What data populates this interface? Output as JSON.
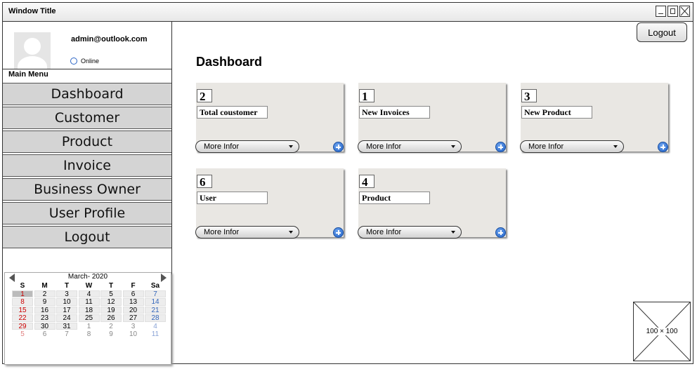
{
  "window": {
    "title": "Window Title"
  },
  "profile": {
    "email": "admin@outlook.com",
    "status": "Online"
  },
  "sidebar": {
    "menu_label": "Main Menu",
    "items": [
      {
        "label": "Dashboard"
      },
      {
        "label": "Customer"
      },
      {
        "label": "Product"
      },
      {
        "label": "Invoice"
      },
      {
        "label": "Business Owner"
      },
      {
        "label": "User Profile"
      },
      {
        "label": "Logout"
      }
    ]
  },
  "calendar": {
    "month_label": "March- 2020",
    "weekdays": [
      "S",
      "M",
      "T",
      "W",
      "T",
      "F",
      "Sa"
    ],
    "selected_day": 1,
    "weeks": [
      [
        1,
        2,
        3,
        4,
        5,
        6,
        7
      ],
      [
        8,
        9,
        10,
        11,
        12,
        13,
        14
      ],
      [
        15,
        16,
        17,
        18,
        19,
        20,
        21
      ],
      [
        22,
        23,
        24,
        25,
        26,
        27,
        28
      ],
      [
        29,
        30,
        31,
        1,
        2,
        3,
        4
      ],
      [
        5,
        6,
        7,
        8,
        9,
        10,
        11
      ]
    ],
    "colors": {
      "sunday": "#cc0000",
      "saturday": "#3366bb"
    }
  },
  "header": {
    "logout_label": "Logout"
  },
  "main": {
    "title": "Dashboard",
    "cards": [
      {
        "count": "2",
        "label": "Total coustomer",
        "select_value": "More Infor"
      },
      {
        "count": "1",
        "label": "New Invoices",
        "select_value": "More Infor"
      },
      {
        "count": "3",
        "label": "New Product",
        "select_value": "More Infor"
      },
      {
        "count": "6",
        "label": "User",
        "select_value": "More Infor"
      },
      {
        "count": "4",
        "label": "Product",
        "select_value": "More Infor"
      }
    ]
  },
  "image_placeholder": {
    "label": "100 × 100"
  }
}
